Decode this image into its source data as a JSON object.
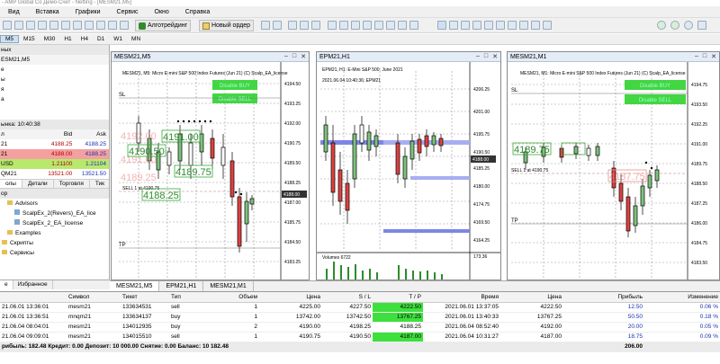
{
  "titlebar": {
    "text": "- AMP Global Co Демо-Счет - Netting - [MESM21,M5]"
  },
  "menu": [
    "Вид",
    "Вставка",
    "Графики",
    "Сервис",
    "Окно",
    "Справка"
  ],
  "toolbar": {
    "algo_label": "Алготрейдинг",
    "new_order_label": "Новый ордер"
  },
  "timeframes": [
    "M5",
    "M15",
    "M30",
    "H1",
    "H4",
    "D1",
    "W1",
    "MN"
  ],
  "navigator_top": [
    "ных",
    "ESM21,M5",
    "е",
    "ы",
    "я",
    "а"
  ],
  "market_watch": {
    "header": "ынка: 10:40:38",
    "columns": [
      "л",
      "Bid",
      "Ask"
    ],
    "rows": [
      {
        "symbol": "21",
        "bid": "4188.25",
        "ask": "4188.25"
      },
      {
        "symbol": "21",
        "bid": "4188.00",
        "ask": "4188.25"
      },
      {
        "symbol": "USD",
        "bid": "1.21100",
        "ask": "1.21104"
      },
      {
        "symbol": "QM21",
        "bid": "13521.00",
        "ask": "13521.50"
      }
    ]
  },
  "mw_tabs": [
    "олы",
    "Детали",
    "Торговля",
    "Тик"
  ],
  "navigator": {
    "header": "ор",
    "items": [
      "Advisors",
      "ScalpEx_2(Revers)_EA_lice",
      "ScalpEx_2_EA_license",
      "Examples",
      "Скрипты",
      "Сервисы"
    ]
  },
  "left_bottom_tabs": [
    "е",
    "Избранное"
  ],
  "charts": [
    {
      "title": "MESM21,M5",
      "info": "MESM21, M5: Micro E-mini S&P 500 Index Futures (Jun 21) (C) Scalp_EA_license",
      "buy_btn": "Disable BUY",
      "sell_btn": "Disable SELL",
      "ticks": [
        "4194.50",
        "4193.25",
        "4192.00",
        "4190.75",
        "4189.50",
        "4188.25",
        "4187.00",
        "4185.75",
        "4184.50",
        "4183.25"
      ],
      "price_tag": "4188.00",
      "boxes": [
        "4191.00",
        "4190.50",
        "4189.75",
        "4188.25"
      ],
      "faint": [
        "4192.00",
        "4191.00",
        "4189.25"
      ],
      "sl": "SL",
      "tp": "TP",
      "sell_line": "SELL 1 at 4190.75"
    },
    {
      "title": "EPM21,H1",
      "info": "EPM21, H1: E-Mini S&P 500: June 2021",
      "date": "2021.06.04 10:40:36; EPM21",
      "ticks": [
        "4206.25",
        "4201.00",
        "4195.75",
        "4190.50",
        "4185.25",
        "4180.00",
        "4174.75",
        "4169.50",
        "4164.25"
      ],
      "price_tag": "4188.00",
      "volumes": "Volumes 6722",
      "vol_tick": "173.36"
    },
    {
      "title": "MESM21,M1",
      "info": "MESM21, M1: Micro E-mini S&P 500 Index Futures (Jun 21) (C) Scalp_EA_license",
      "buy_btn": "Disable BUY",
      "sell_btn": "Disable SELL",
      "ticks": [
        "4194.75",
        "4193.50",
        "4192.25",
        "4191.00",
        "4189.75",
        "4188.50",
        "4187.25",
        "4186.00",
        "4184.75",
        "4183.50"
      ],
      "boxes": [
        "4189.75",
        "4187.75"
      ],
      "sl": "SL",
      "tp": "TP",
      "sell_line": "SELL 1 at 4190.75"
    }
  ],
  "chart_tabs": [
    "MESM21,M5",
    "EPM21,H1",
    "MESM21,M1"
  ],
  "orders": {
    "columns": [
      "",
      "Символ",
      "Тикет",
      "Тип",
      "Объем",
      "Цена",
      "S / L",
      "T / P",
      "Время",
      "Цена",
      "Прибыль",
      "Изменение"
    ],
    "rows": [
      [
        "21.06.01 13:36:01",
        "mesm21",
        "133634531",
        "sell",
        "1",
        "4225.00",
        "4227.50",
        "4222.50",
        "2021.06.01 13:37:05",
        "4222.50",
        "12.50",
        "0.06 %"
      ],
      [
        "21.06.01 13:36:51",
        "mnqm21",
        "133634137",
        "buy",
        "1",
        "13742.00",
        "13742.50",
        "13767.25",
        "2021.06.01 13:40:33",
        "13767.25",
        "50.50",
        "0.18 %"
      ],
      [
        "21.06.04 08:04:01",
        "mesm21",
        "134012935",
        "buy",
        "2",
        "4190.00",
        "4198.25",
        "4188.25",
        "2021.06.04 08:52:40",
        "4192.00",
        "20.00",
        "0.05 %"
      ],
      [
        "21.06.04 09:09:01",
        "mesm21",
        "134015510",
        "sell",
        "1",
        "4190.75",
        "4190.50",
        "4187.00",
        "2021.06.04 10:31:27",
        "4187.00",
        "18.75",
        "0.09 %"
      ]
    ],
    "total": {
      "text": "рибыль: 182.48  Кредит: 0.00  Депозит: 10 000.00  Снятие: 0.00  Баланс: 10 182.48",
      "value": "206.00"
    }
  }
}
